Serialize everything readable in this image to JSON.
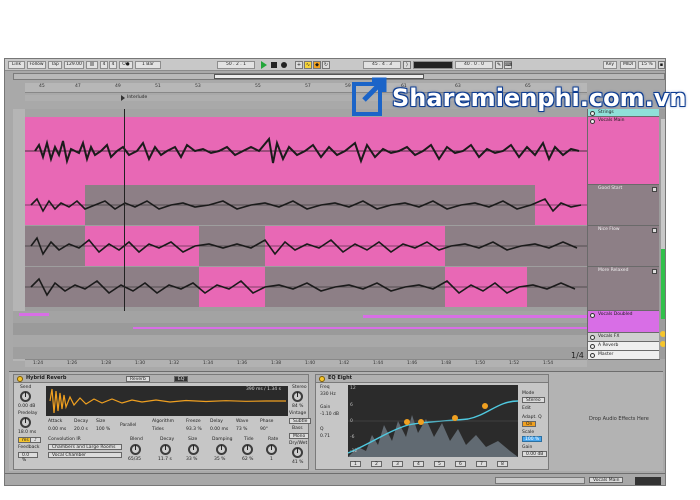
{
  "topbar": {
    "link": "Link",
    "follow": "Follow",
    "tap": "Tap",
    "tempo": "129.00",
    "sig_num": "4",
    "sig_den": "4",
    "metro": "O●",
    "quant": "1 Bar",
    "position": "50 .  2 .  1",
    "loop_start": "45 .  4 .  3",
    "loop_len": "40 .  0 .  0",
    "key": "Key",
    "midi": "MIDI",
    "cpu": "15 %"
  },
  "ruler": {
    "labels": [
      "45",
      "47",
      "49",
      "51",
      "53",
      "55",
      "57",
      "59",
      "61",
      "63",
      "65"
    ]
  },
  "locator": {
    "name": "Interlude"
  },
  "bottom_ruler": {
    "labels": [
      "1:24",
      "1:26",
      "1:28",
      "1:30",
      "1:32",
      "1:34",
      "1:36",
      "1:38",
      "1:40",
      "1:42",
      "1:44",
      "1:46",
      "1:48",
      "1:50",
      "1:52",
      "1:54"
    ]
  },
  "page_indicator": "1/4",
  "tracks": [
    {
      "name": "Strings",
      "color": "#8fe0d9"
    },
    {
      "name": "Vocals Main",
      "color": "#e868b5"
    },
    {
      "name": "Good Start",
      "color": "#8d7f86"
    },
    {
      "name": "Nice Flow",
      "color": "#8d7f86"
    },
    {
      "name": "More Relaxed",
      "color": "#8d7f86"
    },
    {
      "name": "Vocals Doubled",
      "color": "#d86ee6"
    },
    {
      "name": "Vocals FX",
      "color": "#cfcfcf"
    },
    {
      "name": "A Reverb",
      "color": "#efefef"
    },
    {
      "name": "Master",
      "color": "#efefef"
    }
  ],
  "reverb": {
    "title": "Hybrid Reverb",
    "tab_reverb": "Reverb",
    "tab_eq": "EQ",
    "time_readout": "390 ms / 1.34 s",
    "send": "Send",
    "send_val": "0.00 dB",
    "predelay": "Predelay",
    "predelay_val": "18.0 ms",
    "ms": "ms",
    "sync": "♪",
    "feedback": "Feedback",
    "feedback_val": "0.0 %",
    "attack": "Attack",
    "attack_val": "0.00 ms",
    "decay": "Decay",
    "decay_val": "20.0 s",
    "size": "Size",
    "size_val": "100 %",
    "routing": "Parallel",
    "algorithm": "Algorithm",
    "algorithm_val": "Tides",
    "freeze": "Freeze",
    "freeze_val": "93.3 %",
    "delay": "Delay",
    "delay_val": "0.00 ms",
    "wave": "Wave",
    "wave_val": "73 %",
    "phase": "Phase",
    "phase_val": "90°",
    "convolution": "Convolution IR",
    "ir_category": "Chambers and Large Rooms",
    "ir_name": "Vocal Chamber",
    "blend": "Blend",
    "blend_val": "65/35",
    "decay2": "Decay",
    "decay2_val": "11.7 s",
    "size2": "Size",
    "size2_val": "33 %",
    "damping": "Damping",
    "damping_val": "35 %",
    "tide": "Tide",
    "tide_val": "62 %",
    "rate": "Rate",
    "rate_val": "1",
    "stereo": "Stereo",
    "stereo_val": "84 %",
    "vintage": "Vintage",
    "vintage_val": "Subtle",
    "bass": "Bass",
    "bass_val": "Mono",
    "drywet": "Dry/Wet",
    "drywet_val": "41 %"
  },
  "eq": {
    "title": "EQ Eight",
    "freq": "Freq",
    "freq_val": "330 Hz",
    "gain": "Gain",
    "gain_val": "-1.10 dB",
    "q": "Q",
    "q_val": "0.71",
    "db_labels": [
      "12",
      "6",
      "0",
      "-6",
      "-12"
    ],
    "mode": "Mode",
    "mode_val": "Stereo",
    "edit": "Edit",
    "adapt": "Adapt. Q",
    "adapt_val": "On",
    "scale": "Scale",
    "scale_val": "100 %",
    "gain2": "Gain",
    "gain2_val": "0.00 dB",
    "bands": [
      "1",
      "2",
      "3",
      "4",
      "5",
      "6",
      "7",
      "8"
    ]
  },
  "drop_area": "Drop Audio Effects Here",
  "status": {
    "track_label": "Vocals Main"
  },
  "watermark": {
    "text": "Sharemienphi.com.vn"
  },
  "colors": {
    "clip": "#e868b5",
    "lane": "#8d7f86",
    "accent": "#f0a020"
  }
}
